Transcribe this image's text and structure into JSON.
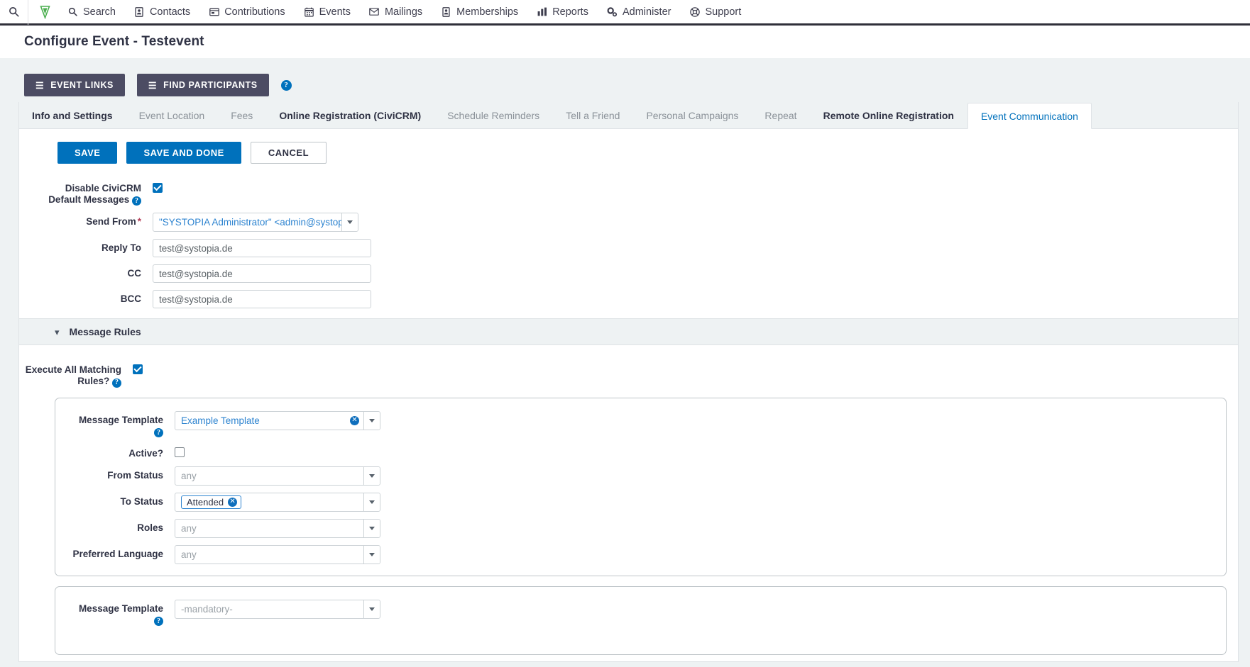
{
  "menubar": {
    "quick_search_icon": "search-icon",
    "logo_icon": "civicrm-logo-icon",
    "items": [
      {
        "label": "Search",
        "icon": "search-icon"
      },
      {
        "label": "Contacts",
        "icon": "contacts-icon"
      },
      {
        "label": "Contributions",
        "icon": "contributions-icon"
      },
      {
        "label": "Events",
        "icon": "calendar-icon"
      },
      {
        "label": "Mailings",
        "icon": "envelope-icon"
      },
      {
        "label": "Memberships",
        "icon": "membership-card-icon"
      },
      {
        "label": "Reports",
        "icon": "bar-chart-icon"
      },
      {
        "label": "Administer",
        "icon": "gears-icon"
      },
      {
        "label": "Support",
        "icon": "lifebuoy-icon"
      }
    ]
  },
  "page": {
    "title": "Configure Event - Testevent"
  },
  "action_strip": {
    "event_links_label": "EVENT LINKS",
    "find_participants_label": "FIND PARTICIPANTS",
    "help_glyph": "?"
  },
  "tabs": [
    {
      "label": "Info and Settings",
      "state": "enabled"
    },
    {
      "label": "Event Location",
      "state": "disabled"
    },
    {
      "label": "Fees",
      "state": "disabled"
    },
    {
      "label": "Online Registration (CiviCRM)",
      "state": "enabled"
    },
    {
      "label": "Schedule Reminders",
      "state": "disabled"
    },
    {
      "label": "Tell a Friend",
      "state": "disabled"
    },
    {
      "label": "Personal Campaigns",
      "state": "disabled"
    },
    {
      "label": "Repeat",
      "state": "disabled"
    },
    {
      "label": "Remote Online Registration",
      "state": "enabled"
    },
    {
      "label": "Event Communication",
      "state": "active"
    }
  ],
  "form_buttons": {
    "save": "SAVE",
    "save_and_done": "SAVE AND DONE",
    "cancel": "CANCEL"
  },
  "fields": {
    "disable_defaults": {
      "label_line1": "Disable CiviCRM",
      "label_line2": "Default Messages",
      "checked": true
    },
    "send_from": {
      "label": "Send From",
      "required_mark": "*",
      "value": "\"SYSTOPIA Administrator\" <admin@systopia.d..."
    },
    "reply_to": {
      "label": "Reply To",
      "value": "test@systopia.de"
    },
    "cc": {
      "label": "CC",
      "value": "test@systopia.de"
    },
    "bcc": {
      "label": "BCC",
      "value": "test@systopia.de"
    }
  },
  "message_rules": {
    "section_title": "Message Rules",
    "chevron": "⌄",
    "execute_all": {
      "label_line1": "Execute All Matching",
      "label_line2": "Rules?",
      "checked": true
    },
    "rules": [
      {
        "message_template": {
          "label": "Message Template",
          "value": "Example Template",
          "is_placeholder": false,
          "clearable": true
        },
        "active": {
          "label": "Active?",
          "checked": false
        },
        "from_status": {
          "label": "From Status",
          "value": "any",
          "is_placeholder": true
        },
        "to_status": {
          "label": "To Status",
          "chip": "Attended"
        },
        "roles": {
          "label": "Roles",
          "value": "any",
          "is_placeholder": true
        },
        "preferred_language": {
          "label": "Preferred Language",
          "value": "any",
          "is_placeholder": true
        }
      },
      {
        "message_template": {
          "label": "Message Template",
          "value": "-mandatory-",
          "is_placeholder": true,
          "clearable": false
        }
      }
    ]
  },
  "colors": {
    "accent_blue": "#0071bc",
    "link_blue": "#2e84d0",
    "dark_navy": "#2f3244",
    "button_dark": "#4c4c63",
    "page_bg": "#eef2f3",
    "required_red": "#b5405a"
  }
}
